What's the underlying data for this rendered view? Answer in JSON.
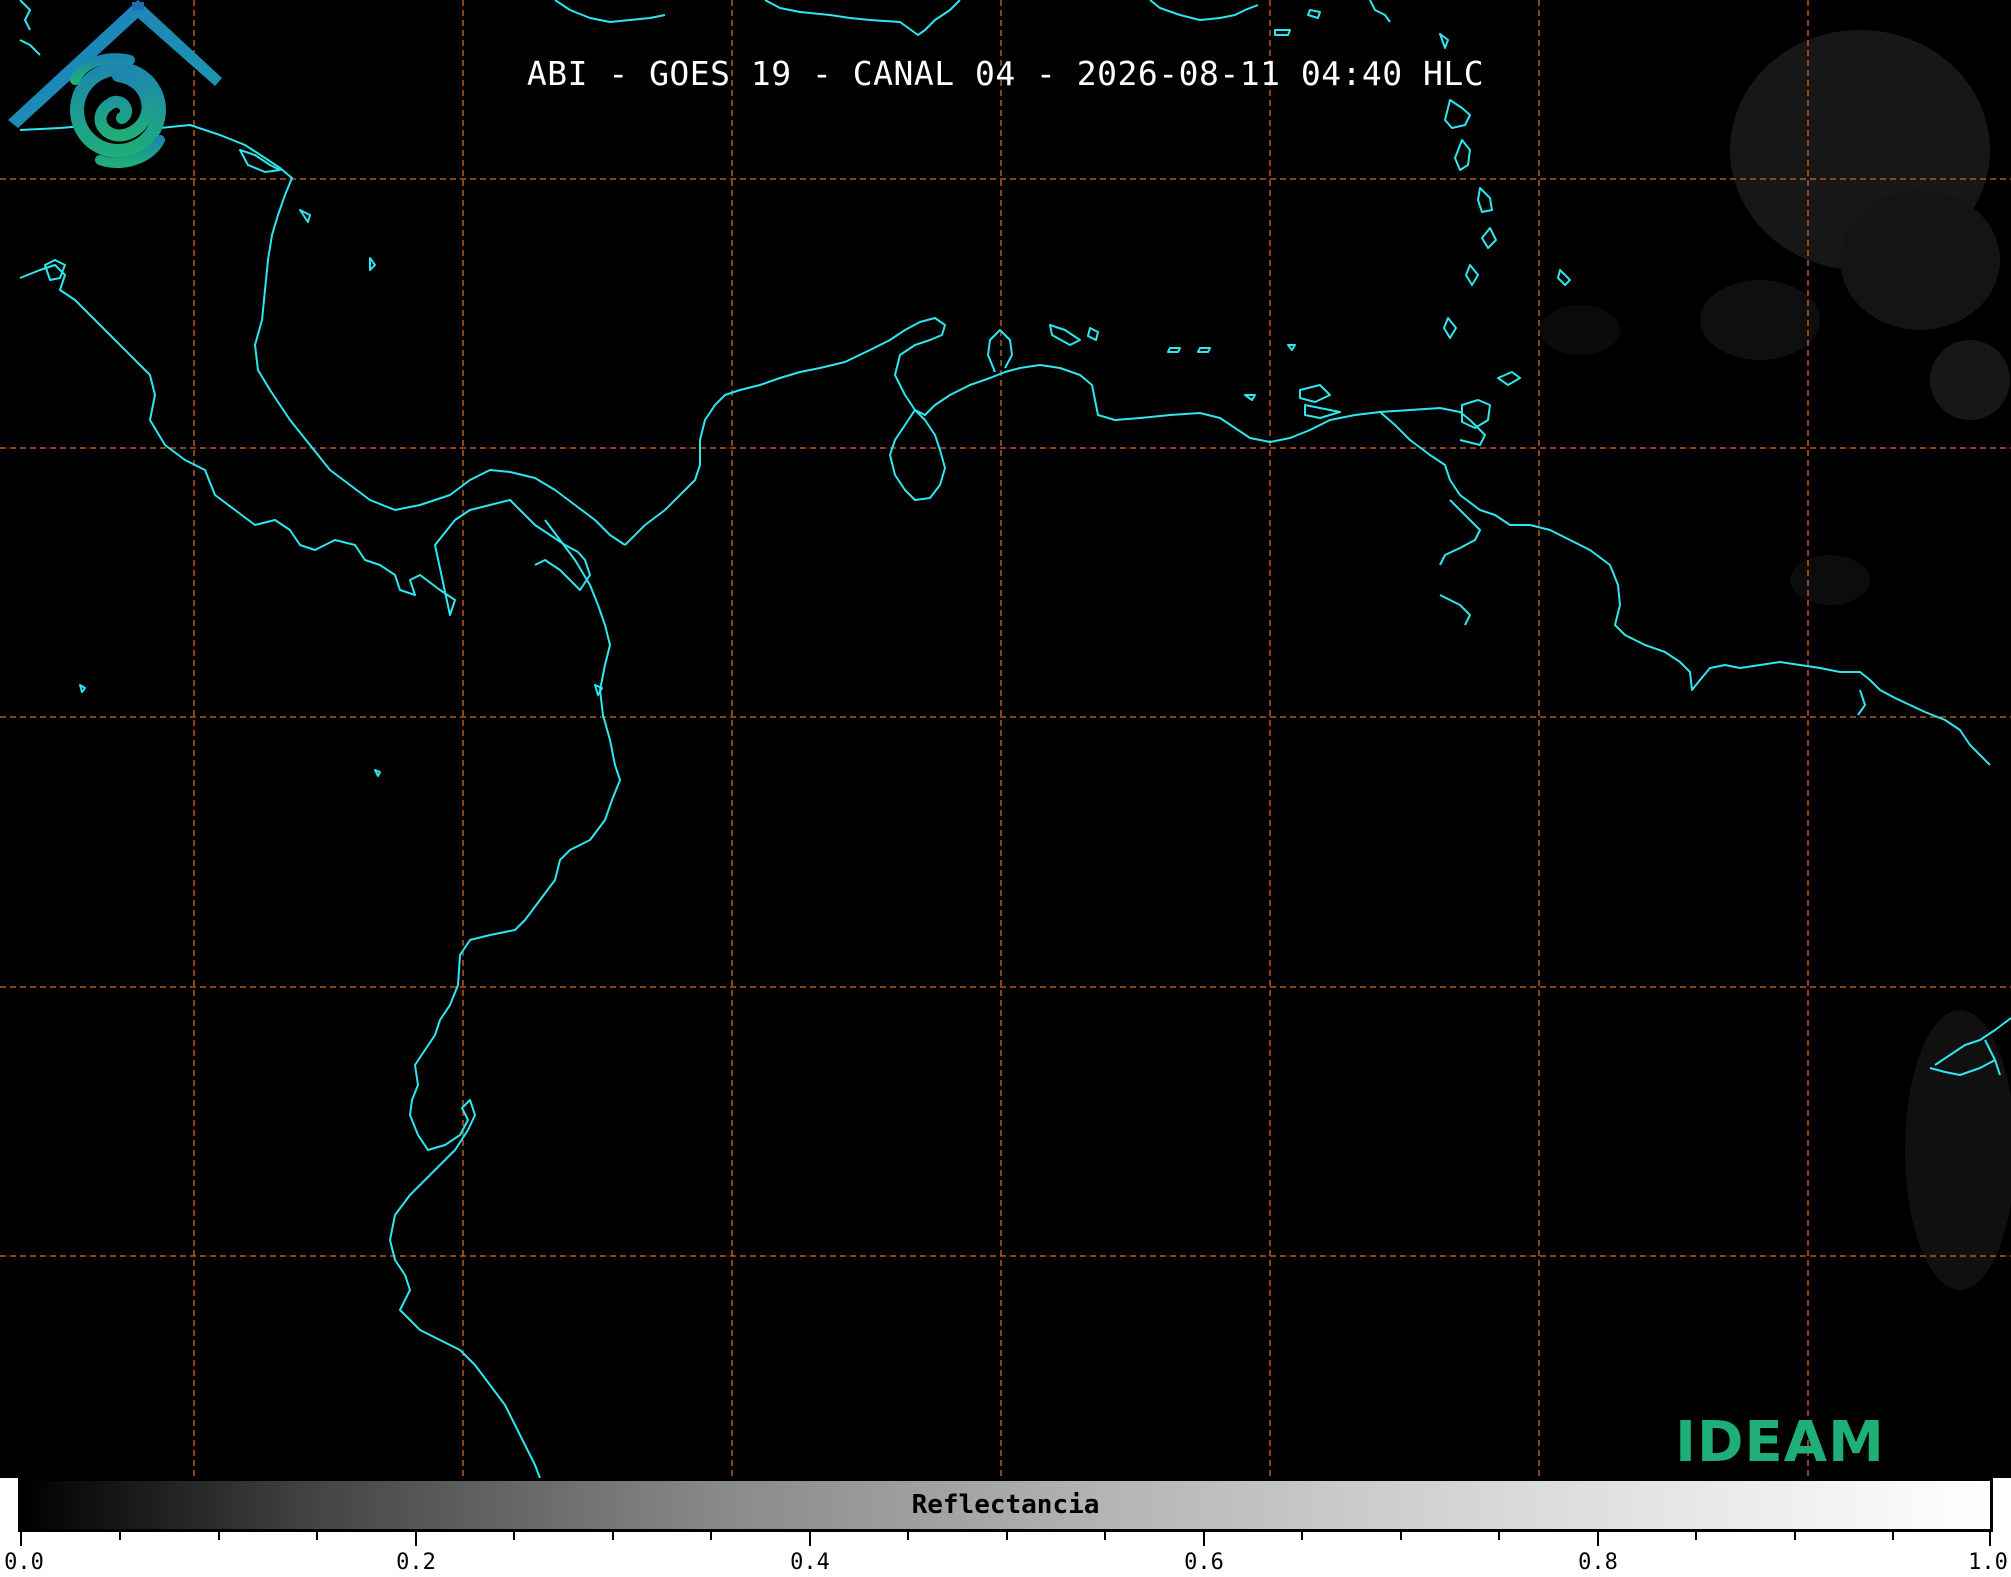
{
  "title": "ABI - GOES 19 - CANAL 04 - 2026-08-11 04:40 HLC",
  "colorbar": {
    "label": "Reflectancia",
    "ticks": [
      "0.0",
      "0.2",
      "0.4",
      "0.6",
      "0.8",
      "1.0"
    ]
  },
  "logo": {
    "text": "IDEAM",
    "icon": "ideam-logo-icon"
  },
  "colors": {
    "background": "#000000",
    "coastline": "#2ee6ee",
    "gridlines": "#d2691e",
    "logo_text": "#1fae77",
    "logo_roof": "#1a6fb5"
  }
}
